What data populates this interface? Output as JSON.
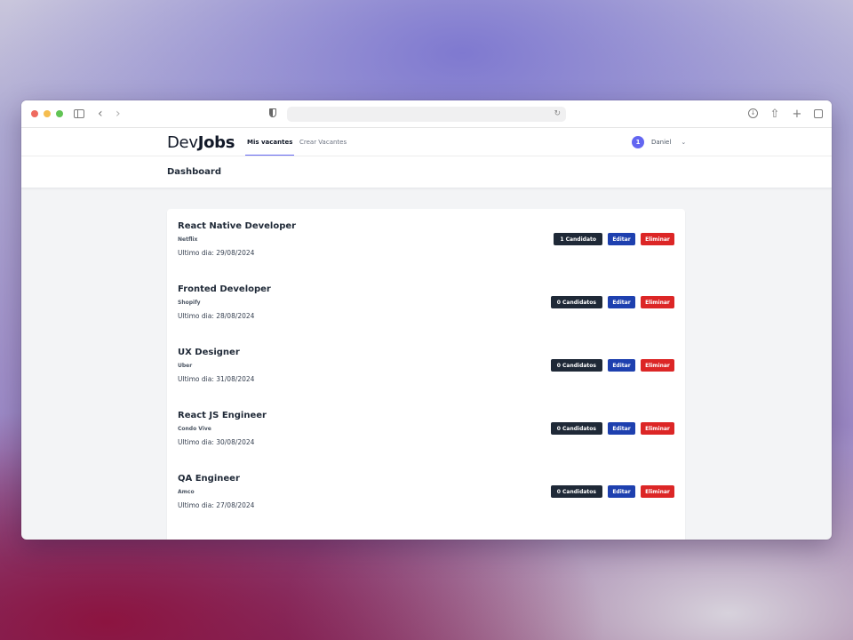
{
  "app": {
    "logo_regular": "Dev",
    "logo_bold": "Jobs"
  },
  "nav": {
    "links": [
      {
        "label": "Mis vacantes",
        "active": true
      },
      {
        "label": "Crear Vacantes",
        "active": false
      }
    ],
    "notifications_count": "1",
    "user_name": "Daniel"
  },
  "header": {
    "title": "Dashboard"
  },
  "jobs": [
    {
      "title": "React Native Developer",
      "company": "Netflix",
      "date": "Ultimo dia: 29/08/2024",
      "candidates": "1 Candidato",
      "edit": "Editar",
      "delete": "Eliminar"
    },
    {
      "title": "Fronted Developer",
      "company": "Shopify",
      "date": "Ultimo dia: 28/08/2024",
      "candidates": "0 Candidatos",
      "edit": "Editar",
      "delete": "Eliminar"
    },
    {
      "title": "UX Designer",
      "company": "Uber",
      "date": "Ultimo dia: 31/08/2024",
      "candidates": "0 Candidatos",
      "edit": "Editar",
      "delete": "Eliminar"
    },
    {
      "title": "React JS Engineer",
      "company": "Condo Vive",
      "date": "Ultimo dia: 30/08/2024",
      "candidates": "0 Candidatos",
      "edit": "Editar",
      "delete": "Eliminar"
    },
    {
      "title": "QA Engineer",
      "company": "Amco",
      "date": "Ultimo dia: 27/08/2024",
      "candidates": "0 Candidatos",
      "edit": "Editar",
      "delete": "Eliminar"
    }
  ],
  "colors": {
    "accent": "#6366f1",
    "candidates_button": "#1f2937",
    "edit_button": "#1e40af",
    "delete_button": "#dc2626"
  },
  "icons": {
    "browser": [
      "sidebar-toggle-icon",
      "back-icon",
      "forward-icon",
      "shield-icon",
      "reload-icon",
      "download-icon",
      "share-icon",
      "new-tab-icon",
      "tabs-overview-icon"
    ],
    "user_menu": "chevron-down-icon"
  }
}
